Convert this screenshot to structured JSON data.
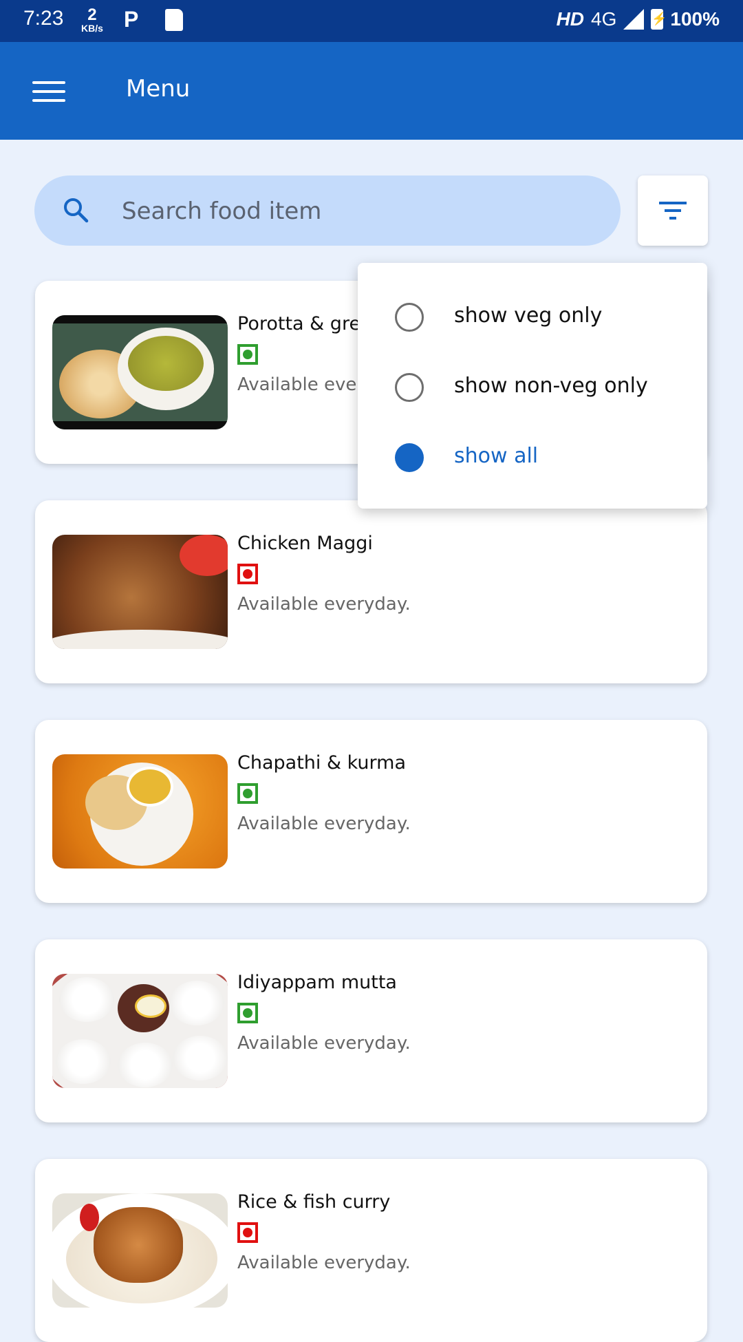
{
  "status_bar": {
    "time": "7:23",
    "speed_value": "2",
    "speed_unit": "KB/s",
    "network_label": "HD",
    "network_type": "4G",
    "battery_pct": "100%",
    "icons": [
      "parking-icon",
      "sd-card-icon",
      "signal-icon",
      "battery-charging-icon"
    ]
  },
  "app_bar": {
    "title": "Menu",
    "menu_icon": "hamburger-menu-icon"
  },
  "search": {
    "placeholder": "Search food item",
    "icon": "search-icon"
  },
  "filter": {
    "icon": "filter-icon",
    "options": [
      {
        "label": "show veg only",
        "selected": false
      },
      {
        "label": "show non-veg only",
        "selected": false
      },
      {
        "label": "show all",
        "selected": true
      }
    ]
  },
  "menu_items": [
    {
      "name": "Porotta & gre",
      "type": "veg",
      "availability": "Available eve"
    },
    {
      "name": "Chicken Maggi",
      "type": "non-veg",
      "availability": "Available everyday."
    },
    {
      "name": "Chapathi & kurma",
      "type": "veg",
      "availability": "Available everyday."
    },
    {
      "name": "Idiyappam mutta",
      "type": "veg",
      "availability": "Available everyday."
    },
    {
      "name": "Rice & fish curry",
      "type": "non-veg",
      "availability": "Available everyday."
    }
  ],
  "colors": {
    "status_bar": "#0a3a8c",
    "app_bar": "#1565c4",
    "background": "#eaf1fc",
    "search_bg": "#c4dbfb",
    "veg": "#2f9e2f",
    "non_veg": "#e01010",
    "accent": "#1565c4"
  }
}
